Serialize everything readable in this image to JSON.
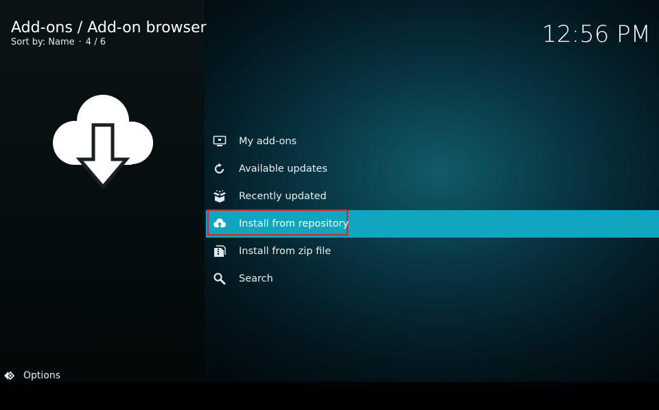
{
  "header": {
    "title": "Add-ons / Add-on browser",
    "sort_label": "Sort by: Name",
    "separator": "·",
    "position": "4 / 6",
    "clock": "12:56 PM"
  },
  "hero": {
    "icon": "cloud-download-icon"
  },
  "menu": {
    "selected_index": 3,
    "items": [
      {
        "label": "My add-ons",
        "icon": "monitor-icon"
      },
      {
        "label": "Available updates",
        "icon": "refresh-icon"
      },
      {
        "label": "Recently updated",
        "icon": "open-box-icon"
      },
      {
        "label": "Install from repository",
        "icon": "cloud-upload-icon"
      },
      {
        "label": "Install from zip file",
        "icon": "zip-file-icon"
      },
      {
        "label": "Search",
        "icon": "search-icon"
      }
    ]
  },
  "footer": {
    "options_label": "Options",
    "options_icon": "options-arrows-icon"
  },
  "colors": {
    "selection": "#11a6c0",
    "highlight_border": "#d2262b",
    "text": "#e8f0f2"
  }
}
